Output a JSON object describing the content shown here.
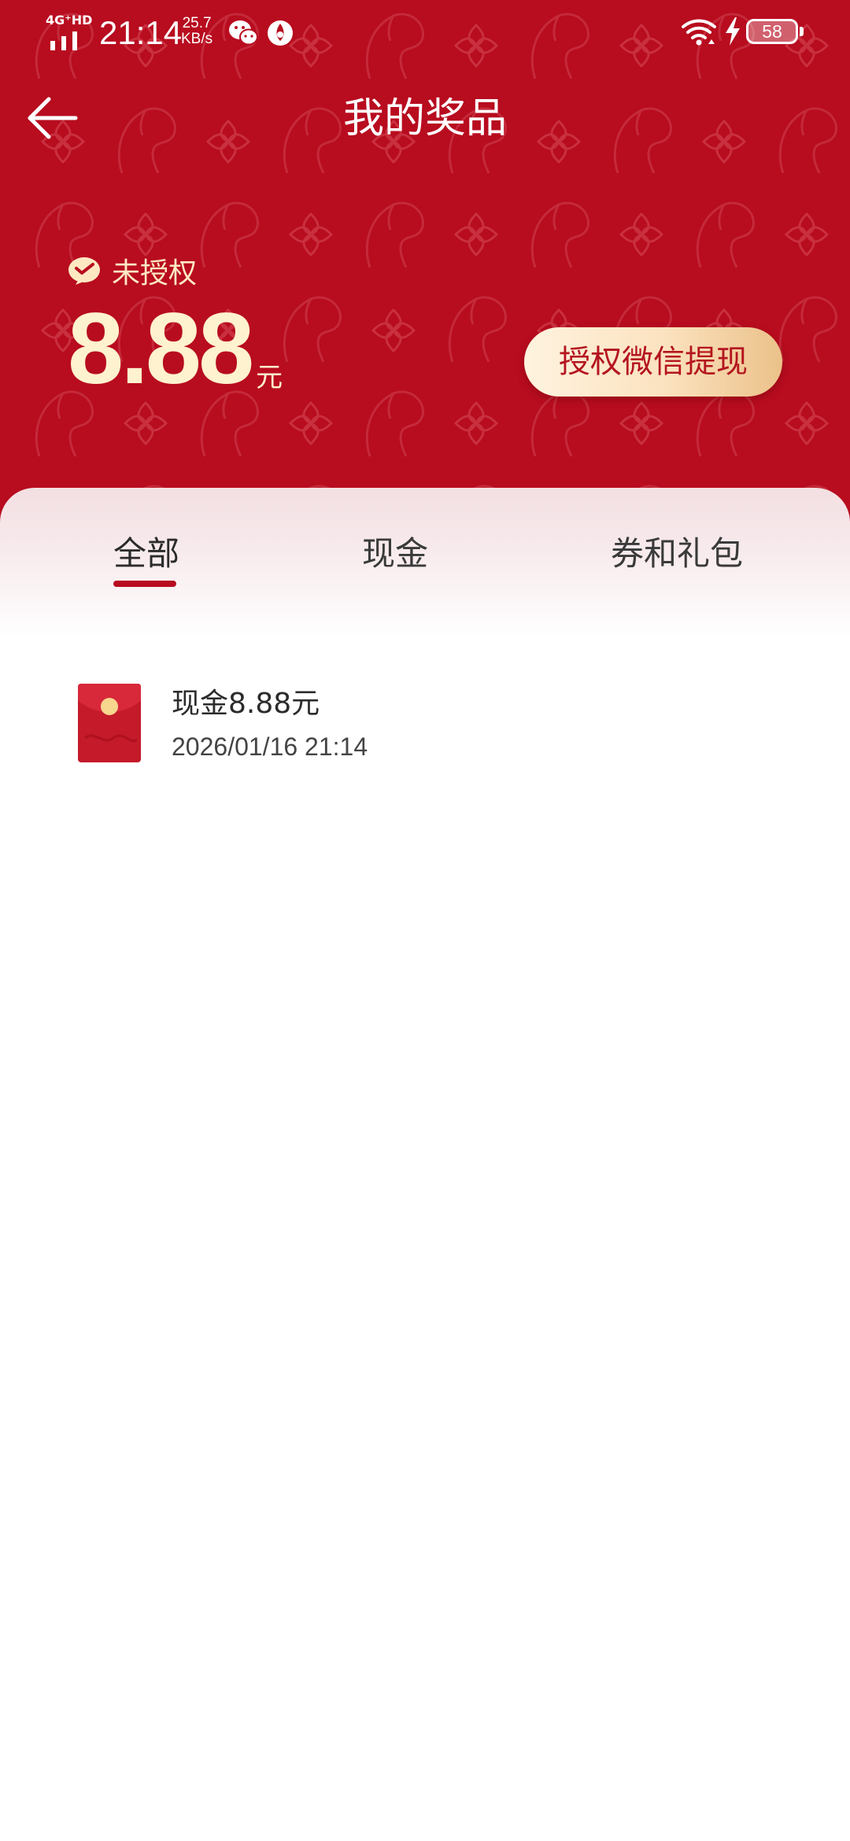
{
  "status_bar": {
    "network": "4G⁺HD",
    "time": "21:14",
    "speed_value": "25.7",
    "speed_unit": "KB/s",
    "battery": "58",
    "icons": [
      "signal-icon",
      "wechat-icon",
      "app-notification-icon",
      "wifi-icon",
      "charging-icon",
      "battery-icon"
    ]
  },
  "header": {
    "title": "我的奖品",
    "back_icon": "arrow-left-icon"
  },
  "balance": {
    "auth_status": "未授权",
    "auth_icon": "wechat-pay-icon",
    "amount": "8.88",
    "unit": "元",
    "withdraw_button": "授权微信提现"
  },
  "tabs": [
    {
      "label": "全部",
      "active": true
    },
    {
      "label": "现金",
      "active": false
    },
    {
      "label": "券和礼包",
      "active": false
    }
  ],
  "prizes": [
    {
      "title": "现金8.88元",
      "date": "2026/01/16 21:14",
      "icon": "red-envelope-icon"
    }
  ],
  "colors": {
    "header_red": "#b80c1f",
    "amount_cream": "#fff2cf",
    "button_gold": "#fbe2bf",
    "button_text": "#b4151f",
    "tab_indicator": "#b80c1f"
  }
}
